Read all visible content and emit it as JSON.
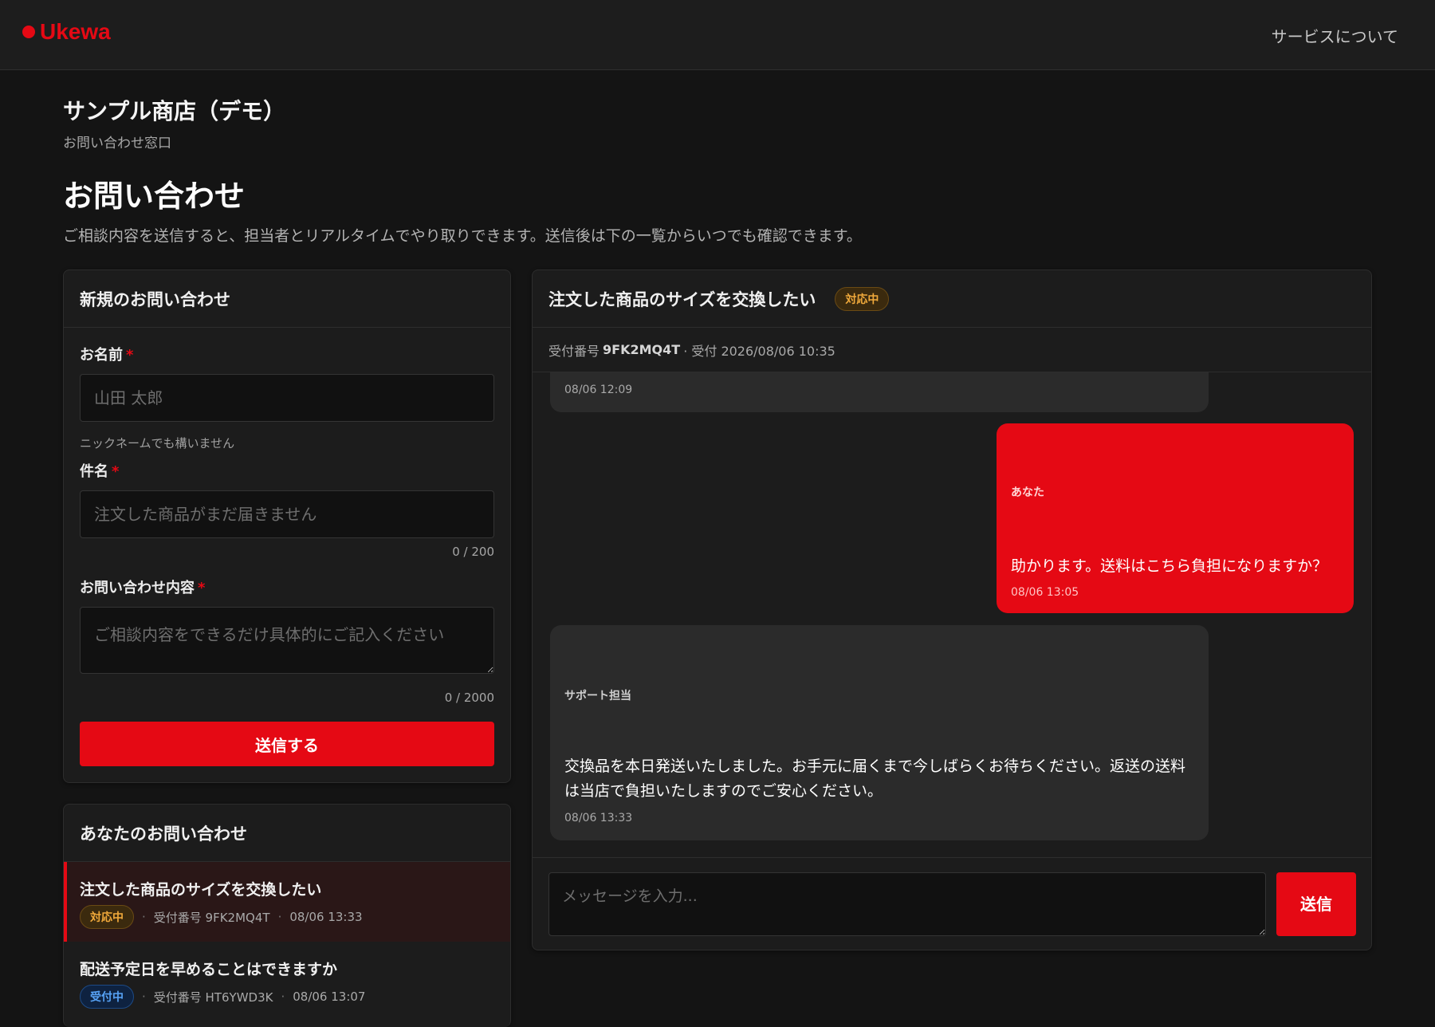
{
  "header": {
    "logo_text": "Ukewa",
    "nav_about": "サービスについて"
  },
  "shop": {
    "name": "サンプル商店（デモ）",
    "subtitle": "お問い合わせ窓口"
  },
  "page": {
    "title": "お問い合わせ",
    "description": "ご相談内容を送信すると、担当者とリアルタイムでやり取りできます。送信後は下の一覧からいつでも確認できます。"
  },
  "form": {
    "title": "新規のお問い合わせ",
    "name_label": "お名前",
    "name_placeholder": "山田 太郎",
    "name_hint": "ニックネームでも構いません",
    "subject_label": "件名",
    "subject_placeholder": "注文した商品がまだ届きません",
    "subject_counter": "0 / 200",
    "body_label": "お問い合わせ内容",
    "body_placeholder": "ご相談内容をできるだけ具体的にご記入ください",
    "body_counter": "0 / 2000",
    "required_mark": "*",
    "submit_label": "送信する"
  },
  "inquiries": {
    "title": "あなたのお問い合わせ",
    "items": [
      {
        "title": "注文した商品のサイズを交換したい",
        "status": "対応中",
        "ticket": "受付番号 9FK2MQ4T",
        "time": "08/06 13:33",
        "active": true
      },
      {
        "title": "配送予定日を早めることはできますか",
        "status": "受付中",
        "ticket": "受付番号 HT6YWD3K",
        "time": "08/06 13:07",
        "active": false
      }
    ]
  },
  "chat": {
    "subject": "注文した商品のサイズを交換したい",
    "status": "対応中",
    "meta_prefix": "受付番号",
    "ticket_id": "9FK2MQ4T",
    "meta_suffix": "· 受付 2026/08/06 10:35",
    "messages": [
      {
        "sender": "",
        "text": "",
        "time": "08/06 12:09",
        "from": "staff"
      },
      {
        "sender": "あなた",
        "text": "助かります。送料はこちら負担になりますか？",
        "time": "08/06 13:05",
        "from": "user"
      },
      {
        "sender": "サポート担当",
        "text": "交換品を本日発送いたしました。お手元に届くまで今しばらくお待ちください。返送の送料は当店で負担いたしますのでご安心ください。",
        "time": "08/06 13:33",
        "from": "staff"
      }
    ],
    "input_placeholder": "メッセージを入力...",
    "send_label": "送信"
  },
  "colors": {
    "accent": "#e50914",
    "background": "#141414",
    "card": "#1c1c1c",
    "status_in_progress": "#f0a93b",
    "status_received": "#57a2f5"
  }
}
